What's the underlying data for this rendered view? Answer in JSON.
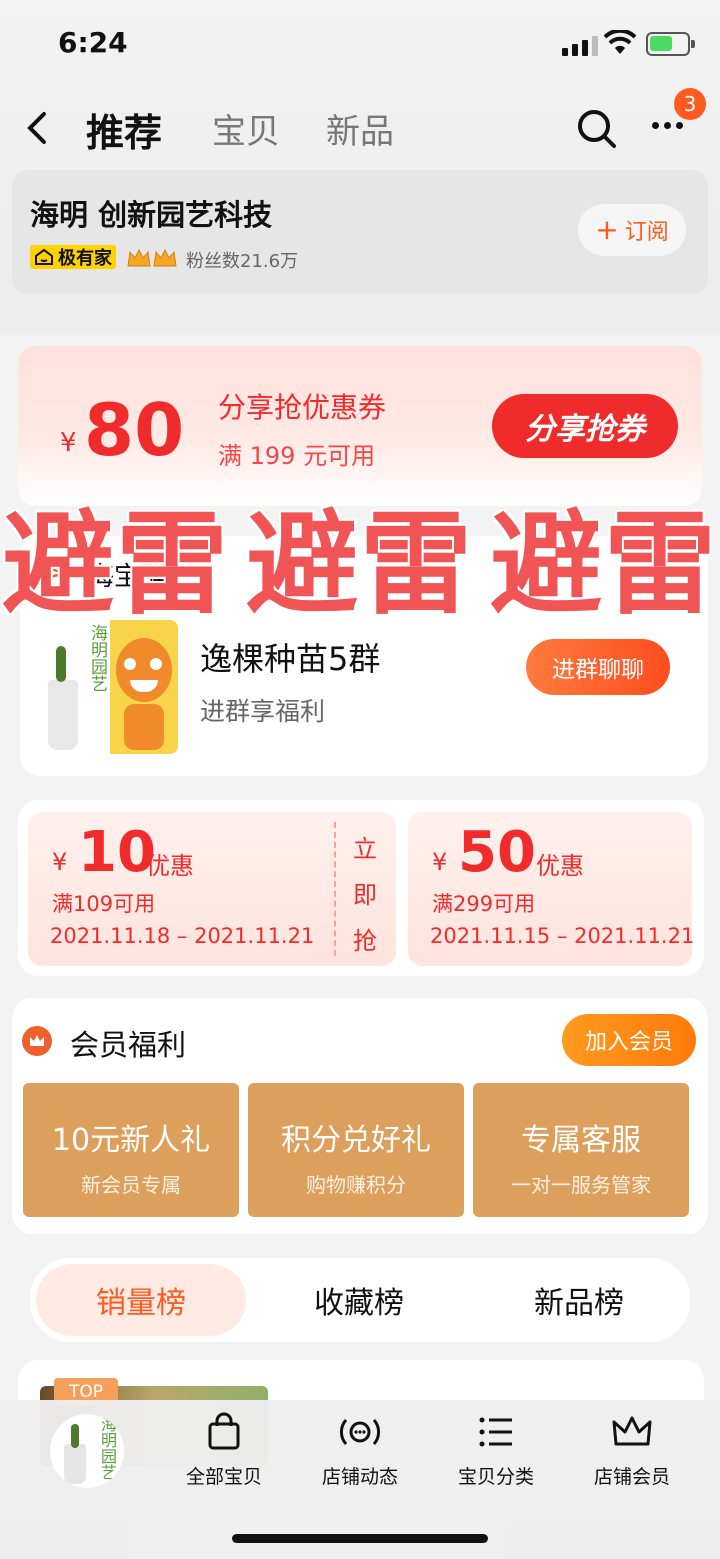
{
  "status": {
    "time": "6:24"
  },
  "nav": {
    "back_label": "<",
    "tabs": [
      {
        "label": "推荐"
      },
      {
        "label": "宝贝"
      },
      {
        "label": "新品"
      }
    ],
    "badge_count": "3"
  },
  "shop": {
    "name": "海明 创新园艺科技",
    "tag": "极有家",
    "fans": "粉丝数21.6万",
    "subscribe_label": "订阅"
  },
  "share_coupon": {
    "currency": "¥",
    "amount": "80",
    "title": "分享抢优惠券",
    "condition": "满 199 元可用",
    "button": "分享抢券"
  },
  "watermark": {
    "items": [
      "避雷",
      "避雷",
      "避雷"
    ]
  },
  "group": {
    "header": "海宝群",
    "name": "逸棵种苗5群",
    "desc": "进群享福利",
    "button": "进群聊聊",
    "logo_text": "海明园艺"
  },
  "coupons": [
    {
      "currency": "¥",
      "amount": "10",
      "unit": "优惠",
      "condition": "满109可用",
      "dates": "2021.11.18 – 2021.11.21",
      "action": [
        "立",
        "即",
        "抢"
      ]
    },
    {
      "currency": "¥",
      "amount": "50",
      "unit": "优惠",
      "condition": "满299可用",
      "dates": "2021.11.15 – 2021.11.21"
    }
  ],
  "member": {
    "title": "会员福利",
    "join": "加入会员",
    "benefits": [
      {
        "title": "10元新人礼",
        "sub": "新会员专属"
      },
      {
        "title": "积分兑好礼",
        "sub": "购物赚积分"
      },
      {
        "title": "专属客服",
        "sub": "一对一服务管家"
      }
    ]
  },
  "rank_tabs": [
    {
      "label": "销量榜"
    },
    {
      "label": "收藏榜"
    },
    {
      "label": "新品榜"
    }
  ],
  "product": {
    "top_badge": "TOP"
  },
  "bottom_nav": [
    {
      "label": "全部宝贝",
      "icon": "bag-icon"
    },
    {
      "label": "店铺动态",
      "icon": "broadcast-icon"
    },
    {
      "label": "宝贝分类",
      "icon": "list-icon"
    },
    {
      "label": "店铺会员",
      "icon": "crown-icon"
    }
  ],
  "colors": {
    "accent": "#ff4d1f",
    "coupon_red": "#f02b2b",
    "member_gold": "#dda05c"
  }
}
